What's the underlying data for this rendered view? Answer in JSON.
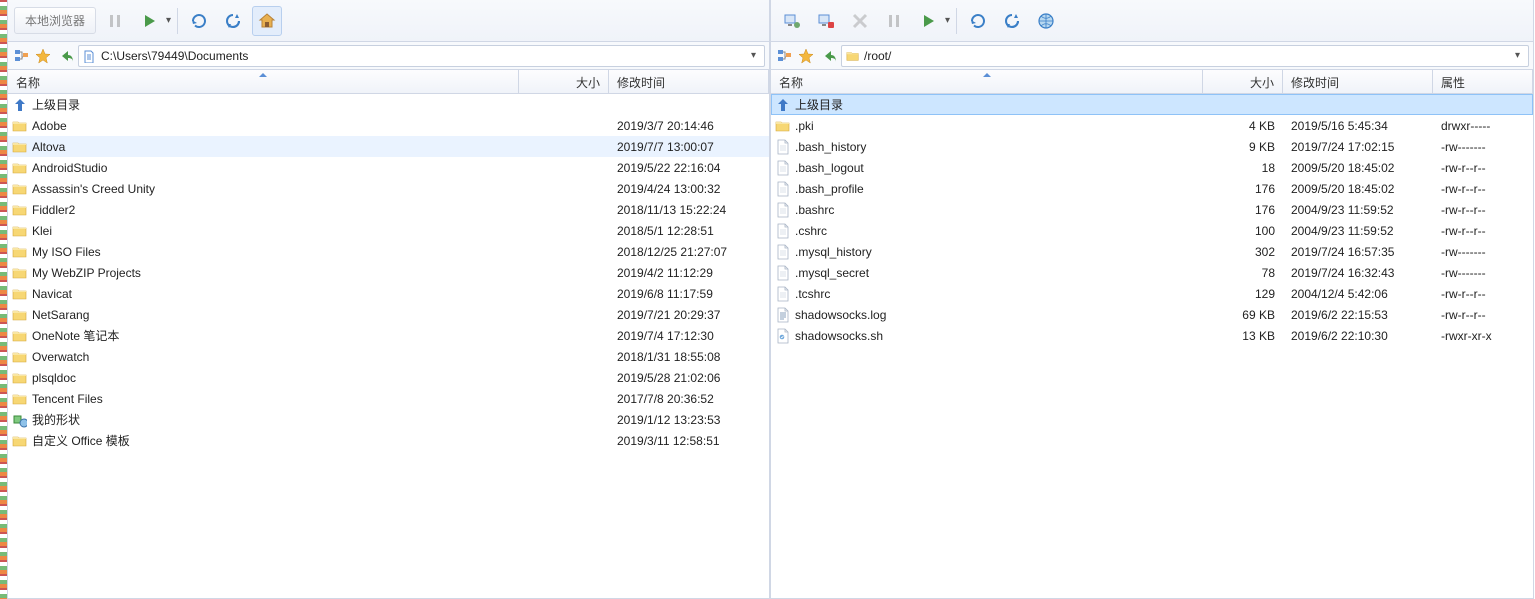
{
  "left": {
    "title": "本地浏览器",
    "path": "C:\\Users\\79449\\Documents",
    "columns": {
      "name": "名称",
      "size": "大小",
      "modified": "修改时间"
    },
    "parent": "上级目录",
    "rows": [
      {
        "icon": "folder",
        "name": "Adobe",
        "size": "",
        "modified": "2019/3/7 20:14:46"
      },
      {
        "icon": "folder",
        "name": "Altova",
        "size": "",
        "modified": "2019/7/7 13:00:07",
        "hover": true
      },
      {
        "icon": "folder",
        "name": "AndroidStudio",
        "size": "",
        "modified": "2019/5/22 22:16:04"
      },
      {
        "icon": "folder",
        "name": "Assassin's Creed Unity",
        "size": "",
        "modified": "2019/4/24 13:00:32"
      },
      {
        "icon": "folder",
        "name": "Fiddler2",
        "size": "",
        "modified": "2018/11/13 15:22:24"
      },
      {
        "icon": "folder",
        "name": "Klei",
        "size": "",
        "modified": "2018/5/1 12:28:51"
      },
      {
        "icon": "folder",
        "name": "My ISO Files",
        "size": "",
        "modified": "2018/12/25 21:27:07"
      },
      {
        "icon": "folder",
        "name": "My WebZIP Projects",
        "size": "",
        "modified": "2019/4/2 11:12:29"
      },
      {
        "icon": "folder",
        "name": "Navicat",
        "size": "",
        "modified": "2019/6/8 11:17:59"
      },
      {
        "icon": "folder",
        "name": "NetSarang",
        "size": "",
        "modified": "2019/7/21 20:29:37"
      },
      {
        "icon": "folder",
        "name": "OneNote 笔记本",
        "size": "",
        "modified": "2019/7/4 17:12:30"
      },
      {
        "icon": "folder",
        "name": "Overwatch",
        "size": "",
        "modified": "2018/1/31 18:55:08"
      },
      {
        "icon": "folder",
        "name": "plsqldoc",
        "size": "",
        "modified": "2019/5/28 21:02:06"
      },
      {
        "icon": "folder",
        "name": "Tencent Files",
        "size": "",
        "modified": "2017/7/8 20:36:52"
      },
      {
        "icon": "shapes",
        "name": "我的形状",
        "size": "",
        "modified": "2019/1/12 13:23:53"
      },
      {
        "icon": "folder",
        "name": "自定义 Office 模板",
        "size": "",
        "modified": "2019/3/11 12:58:51"
      }
    ]
  },
  "right": {
    "path": "/root/",
    "columns": {
      "name": "名称",
      "size": "大小",
      "modified": "修改时间",
      "perm": "属性"
    },
    "parent": "上级目录",
    "rows": [
      {
        "icon": "folder",
        "name": ".pki",
        "size": "4 KB",
        "modified": "2019/5/16 5:45:34",
        "perm": "drwxr-----"
      },
      {
        "icon": "file",
        "name": ".bash_history",
        "size": "9 KB",
        "modified": "2019/7/24 17:02:15",
        "perm": "-rw-------"
      },
      {
        "icon": "file",
        "name": ".bash_logout",
        "size": "18",
        "modified": "2009/5/20 18:45:02",
        "perm": "-rw-r--r--"
      },
      {
        "icon": "file",
        "name": ".bash_profile",
        "size": "176",
        "modified": "2009/5/20 18:45:02",
        "perm": "-rw-r--r--"
      },
      {
        "icon": "file",
        "name": ".bashrc",
        "size": "176",
        "modified": "2004/9/23 11:59:52",
        "perm": "-rw-r--r--"
      },
      {
        "icon": "file",
        "name": ".cshrc",
        "size": "100",
        "modified": "2004/9/23 11:59:52",
        "perm": "-rw-r--r--"
      },
      {
        "icon": "file",
        "name": ".mysql_history",
        "size": "302",
        "modified": "2019/7/24 16:57:35",
        "perm": "-rw-------"
      },
      {
        "icon": "file",
        "name": ".mysql_secret",
        "size": "78",
        "modified": "2019/7/24 16:32:43",
        "perm": "-rw-------"
      },
      {
        "icon": "file",
        "name": ".tcshrc",
        "size": "129",
        "modified": "2004/12/4 5:42:06",
        "perm": "-rw-r--r--"
      },
      {
        "icon": "log",
        "name": "shadowsocks.log",
        "size": "69 KB",
        "modified": "2019/6/2 22:15:53",
        "perm": "-rw-r--r--"
      },
      {
        "icon": "script",
        "name": "shadowsocks.sh",
        "size": "13 KB",
        "modified": "2019/6/2 22:10:30",
        "perm": "-rwxr-xr-x"
      }
    ]
  }
}
